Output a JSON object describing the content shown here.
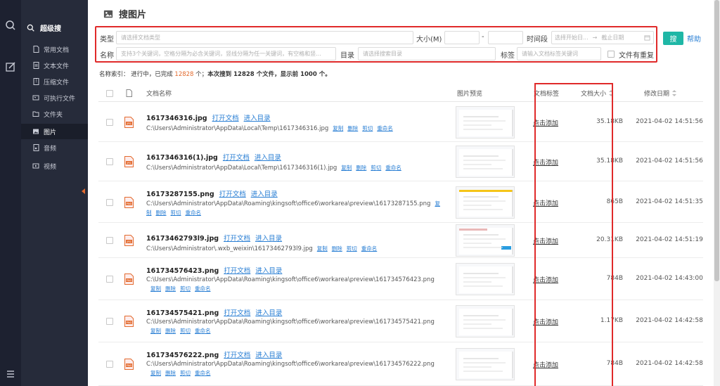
{
  "page_title": "搜图片",
  "rail": {
    "top_icon": "search-icon",
    "mid_icon": "edit-icon",
    "bottom_icon": "menu-icon"
  },
  "sidebar": {
    "brand_label": "超级搜",
    "items": [
      {
        "label": "常用文档",
        "icon": "document-icon"
      },
      {
        "label": "文本文件",
        "icon": "text-file-icon"
      },
      {
        "label": "压缩文件",
        "icon": "archive-icon"
      },
      {
        "label": "可执行文件",
        "icon": "executable-icon"
      },
      {
        "label": "文件夹",
        "icon": "folder-icon"
      },
      {
        "label": "图片",
        "icon": "image-icon"
      },
      {
        "label": "音频",
        "icon": "audio-icon"
      },
      {
        "label": "视频",
        "icon": "video-icon"
      }
    ]
  },
  "filters": {
    "type_label": "类型",
    "type_placeholder": "请选择文档类型",
    "size_label": "大小(M)",
    "size_sep": "-",
    "time_label": "时间段",
    "time_start_placeholder": "选择开始日...",
    "time_arrow": "→",
    "time_end_placeholder": "截止日期",
    "name_label": "名称",
    "name_placeholder": "支持3个关键词，空格分隔为必含关键词，竖线分隔为任一关键词，有空格和竖...",
    "dir_label": "目录",
    "dir_placeholder": "请选择搜索目录",
    "tag_label": "标签",
    "tag_placeholder": "请输入文档标签关键词",
    "dup_label": "文件有重复"
  },
  "search_button": "搜",
  "help_link": "帮助",
  "status": {
    "prefix": "名称索引：  进行中，已完成 ",
    "count": "12828",
    "middle": " 个；",
    "summary": "本次搜到 12828 个文件，显示前 1000 个。"
  },
  "table": {
    "headers": {
      "name": "文档名称",
      "preview": "图片预览",
      "tag": "文档标签",
      "size": "文档大小",
      "date": "修改日期"
    },
    "open_label": "打开文档",
    "dir_label": "进入目录",
    "ops": [
      "复制",
      "删除",
      "剪切",
      "重命名"
    ],
    "add_tag_label": "点击添加",
    "rows": [
      {
        "name": "1617346316.jpg",
        "ext": "JPG",
        "path": "C:\\Users\\Administrator\\AppData\\Local\\Temp\\1617346316.jpg",
        "size": "35.18KB",
        "date": "2021-04-02 14:51:56"
      },
      {
        "name": "1617346316(1).jpg",
        "ext": "JPG",
        "path": "C:\\Users\\Administrator\\AppData\\Local\\Temp\\1617346316(1).jpg",
        "size": "35.18KB",
        "date": "2021-04-02 14:51:56"
      },
      {
        "name": "16173287155.png",
        "ext": "PNG",
        "path": "C:\\Users\\Administrator\\AppData\\Roaming\\kingsoft\\office6\\workarea\\preview\\16173287155.png",
        "size": "865B",
        "date": "2021-04-02 14:51:35"
      },
      {
        "name": "16173462793l9.jpg",
        "ext": "JPG",
        "path": "C:\\Users\\Administrator\\.wxb_weixin\\16173462793l9.jpg",
        "size": "20.31KB",
        "date": "2021-04-02 14:51:19"
      },
      {
        "name": "161734576423.png",
        "ext": "PNG",
        "path": "C:\\Users\\Administrator\\AppData\\Roaming\\kingsoft\\office6\\workarea\\preview\\161734576423.png",
        "size": "784B",
        "date": "2021-04-02 14:43:00"
      },
      {
        "name": "161734575421.png",
        "ext": "PNG",
        "path": "C:\\Users\\Administrator\\AppData\\Roaming\\kingsoft\\office6\\workarea\\preview\\161734575421.png",
        "size": "1.17KB",
        "date": "2021-04-02 14:42:58"
      },
      {
        "name": "161734576222.png",
        "ext": "PNG",
        "path": "C:\\Users\\Administrator\\AppData\\Roaming\\kingsoft\\office6\\workarea\\preview\\161734576222.png",
        "size": "784B",
        "date": "2021-04-02 14:42:58"
      }
    ]
  },
  "colors": {
    "accent": "#1fb7a6",
    "highlight_border": "#e02a2a",
    "link": "#2a7fd4",
    "count": "#e36b2f"
  }
}
